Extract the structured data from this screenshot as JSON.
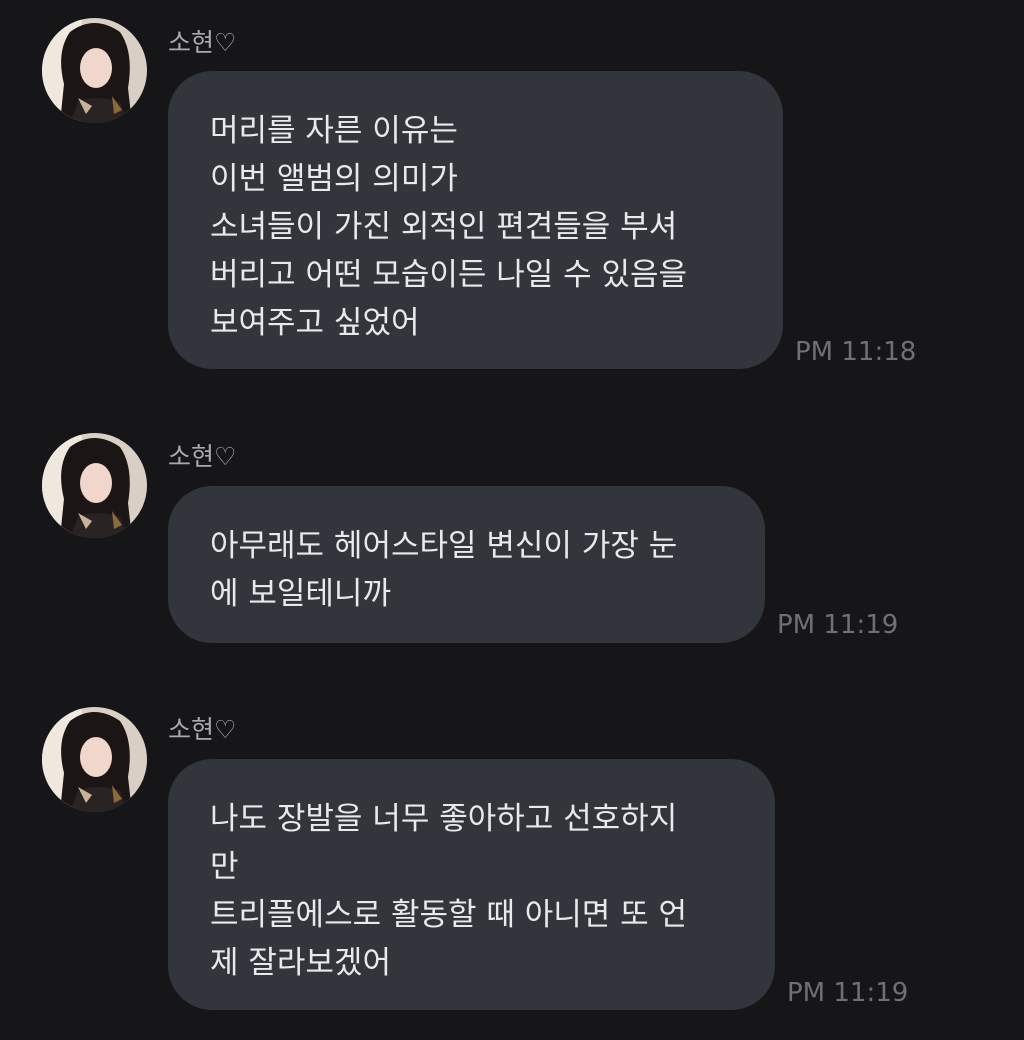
{
  "messages": [
    {
      "sender": "소현♡",
      "lines": [
        "머리를 자른 이유는",
        "이번 앨범의 의미가",
        "소녀들이 가진 외적인 편견들을 부셔",
        "버리고 어떤 모습이든 나일 수 있음을",
        "보여주고 싶었어"
      ],
      "time": "PM 11:18"
    },
    {
      "sender": "소현♡",
      "lines": [
        "아무래도 헤어스타일 변신이 가장 눈",
        "에 보일테니까"
      ],
      "time": "PM 11:19"
    },
    {
      "sender": "소현♡",
      "lines": [
        "나도 장발을 너무 좋아하고 선호하지",
        "만",
        "트리플에스로 활동할 때 아니면 또 언",
        "제 잘라보겠어"
      ],
      "time": "PM 11:19"
    }
  ],
  "colors": {
    "background": "#161619",
    "bubble": "#33353c",
    "message_text": "#e9e9ec",
    "sender_text": "#a9aab1",
    "timestamp_text": "#6e7077"
  },
  "icons": {
    "avatar": "profile-photo"
  }
}
